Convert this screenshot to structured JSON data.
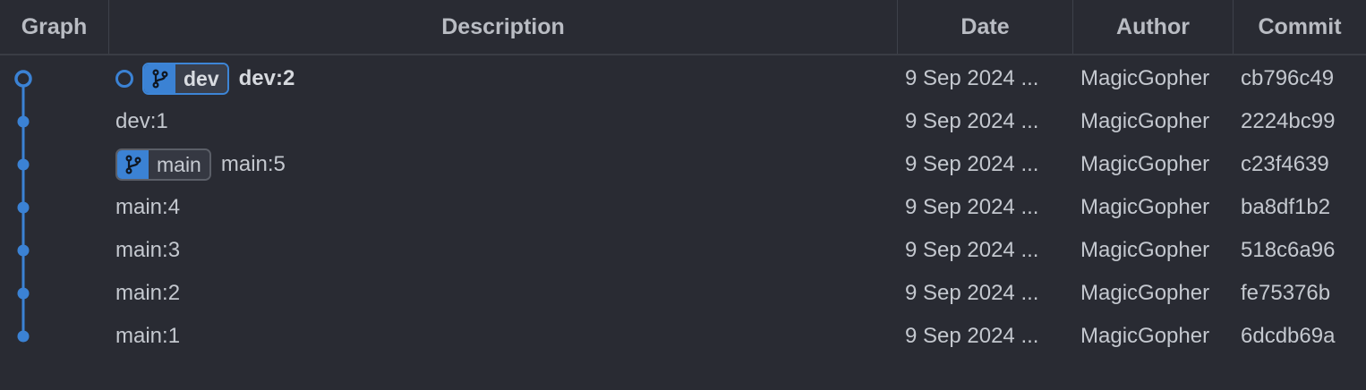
{
  "columns": {
    "graph": "Graph",
    "description": "Description",
    "date": "Date",
    "author": "Author",
    "commit": "Commit"
  },
  "accent_color": "#3b82d4",
  "rows": [
    {
      "message": "dev:2",
      "branch": "dev",
      "is_head": true,
      "date": "9 Sep 2024 ...",
      "author": "MagicGopher",
      "commit": "cb796c49"
    },
    {
      "message": "dev:1",
      "branch": null,
      "is_head": false,
      "date": "9 Sep 2024 ...",
      "author": "MagicGopher",
      "commit": "2224bc99"
    },
    {
      "message": "main:5",
      "branch": "main",
      "is_head": false,
      "date": "9 Sep 2024 ...",
      "author": "MagicGopher",
      "commit": "c23f4639"
    },
    {
      "message": "main:4",
      "branch": null,
      "is_head": false,
      "date": "9 Sep 2024 ...",
      "author": "MagicGopher",
      "commit": "ba8df1b2"
    },
    {
      "message": "main:3",
      "branch": null,
      "is_head": false,
      "date": "9 Sep 2024 ...",
      "author": "MagicGopher",
      "commit": "518c6a96"
    },
    {
      "message": "main:2",
      "branch": null,
      "is_head": false,
      "date": "9 Sep 2024 ...",
      "author": "MagicGopher",
      "commit": "fe75376b"
    },
    {
      "message": "main:1",
      "branch": null,
      "is_head": false,
      "date": "9 Sep 2024 ...",
      "author": "MagicGopher",
      "commit": "6dcdb69a"
    }
  ],
  "icons": {
    "branch": "git-branch-icon",
    "head": "head-commit-ring-icon",
    "commit_dot": "commit-dot-icon"
  }
}
